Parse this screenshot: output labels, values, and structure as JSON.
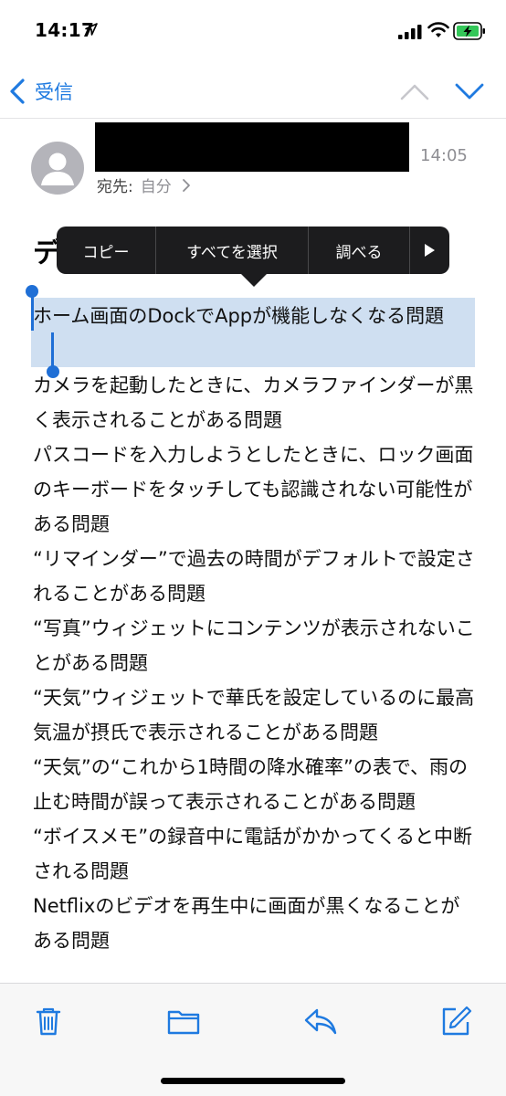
{
  "status_bar": {
    "time": "14:17"
  },
  "nav": {
    "back_label": "受信"
  },
  "header": {
    "time": "14:05",
    "to_label": "宛先:",
    "to_value": "自分"
  },
  "subject_partial": "デ",
  "context_menu": {
    "items": [
      "コピー",
      "すべてを選択",
      "調べる"
    ]
  },
  "body": {
    "selected_line": "ホーム画面のDockでAppが機能しなくなる問題",
    "lines": [
      "カメラを起動したときに、カメラファインダーが黒く表示されることがある問題",
      "パスコードを入力しようとしたときに、ロック画面のキーボードをタッチしても認識されない可能性がある問題",
      "“リマインダー”で過去の時間がデフォルトで設定されることがある問題",
      "“写真”ウィジェットにコンテンツが表示されないことがある問題",
      "“天気”ウィジェットで華氏を設定しているのに最高気温が摂氏で表示されることがある問題",
      "“天気”の“これから1時間の降水確率”の表で、雨の止む時間が誤って表示されることがある問題",
      "“ボイスメモ”の録音中に電話がかかってくると中断される問題",
      "Netflixのビデオを再生中に画面が黒くなることがある問題"
    ]
  },
  "colors": {
    "accent": "#1f7ae0",
    "selection": "#cfdff1",
    "menu_bg": "#1c1c1e",
    "battery_green": "#34c759"
  }
}
